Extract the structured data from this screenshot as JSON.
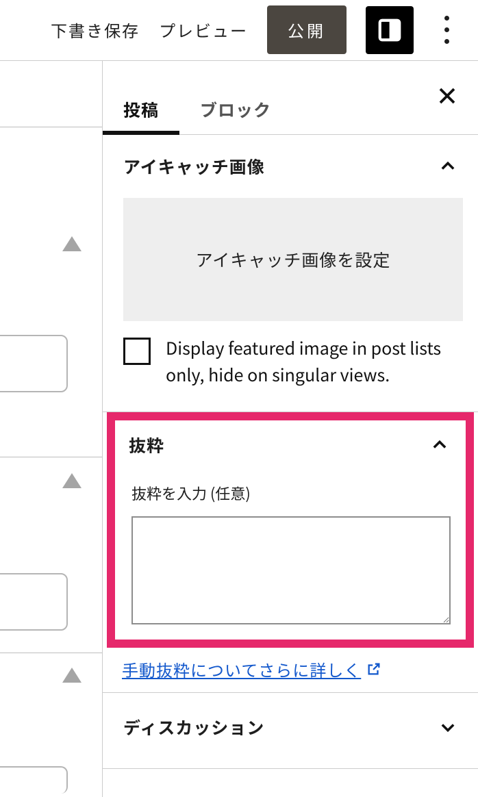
{
  "toolbar": {
    "save_draft": "下書き保存",
    "preview": "プレビュー",
    "publish": "公開"
  },
  "tabs": {
    "post": "投稿",
    "block": "ブロック"
  },
  "panels": {
    "featured": {
      "title": "アイキャッチ画像",
      "dropzone": "アイキャッチ画像を設定",
      "checkbox_label": "Display featured image in post lists only, hide on singular views."
    },
    "excerpt": {
      "title": "抜粋",
      "label": "抜粋を入力 (任意)",
      "value": "",
      "help_link": "手動抜粋についてさらに詳しく"
    },
    "discussion": {
      "title": "ディスカッション"
    }
  }
}
